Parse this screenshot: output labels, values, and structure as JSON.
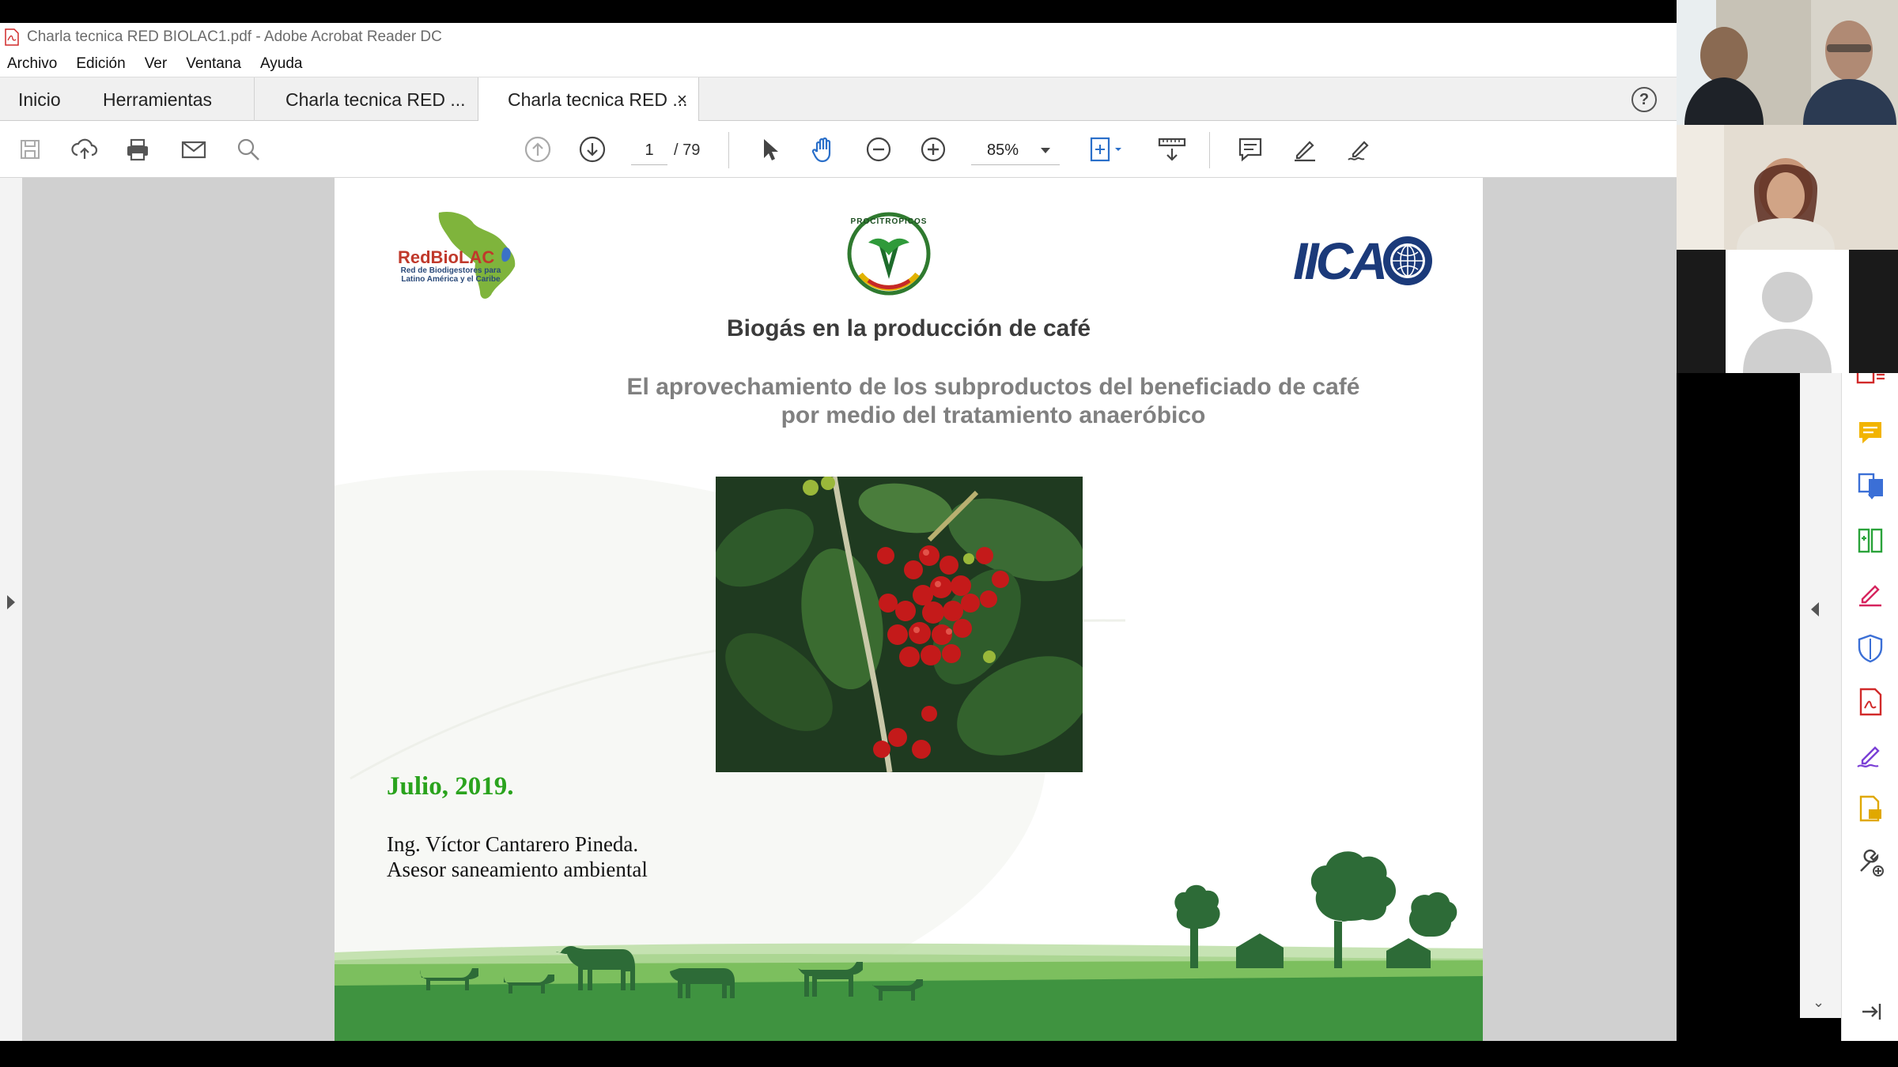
{
  "window": {
    "title": "Charla tecnica RED BIOLAC1.pdf - Adobe Acrobat Reader DC"
  },
  "menu": [
    "Archivo",
    "Edición",
    "Ver",
    "Ventana",
    "Ayuda"
  ],
  "tabs": {
    "home": "Inicio",
    "tools": "Herramientas",
    "doc1": "Charla tecnica RED ...",
    "doc2": "Charla tecnica RED ...",
    "close": "×",
    "help": "?"
  },
  "toolbar": {
    "page_current": "1",
    "page_total": "/ 79",
    "zoom": "85%"
  },
  "icons": {
    "toolbar": [
      "save-icon",
      "upload-icon",
      "print-icon",
      "email-icon",
      "find-icon",
      "page-up-icon",
      "page-down-icon",
      "select-arrow-icon",
      "hand-icon",
      "zoom-out-icon",
      "zoom-in-icon",
      "fit-page-icon",
      "scroll-mode-icon",
      "comment-icon",
      "highlight-pen-icon",
      "sign-icon"
    ],
    "right_tools": [
      "export-pdf-icon",
      "comment-icon",
      "export-convert-icon",
      "organize-pages-icon",
      "fill-sign-icon",
      "protect-icon",
      "create-pdf-icon",
      "edit-sign-icon",
      "send-review-icon",
      "more-tools-icon",
      "expand-pane-icon"
    ]
  },
  "colors": {
    "green_date": "#2aa31d",
    "title_text": "#3b3b3b",
    "subtitle_text": "#808080",
    "pasture_green": "#3f9340",
    "iica_blue": "#1b3a7a",
    "acrobat_red": "#d12a2a"
  },
  "slide": {
    "logo_left": {
      "name": "RedBioLAC",
      "sub": "Red de Biodigestores para Latino América y el Caribe"
    },
    "logo_center": "PROCITROPICOS",
    "logo_right": "IICA",
    "title": "Biogás en la producción de café",
    "subtitle_line1": "El aprovechamiento de los subproductos del beneficiado de café",
    "subtitle_line2": "por medio del tratamiento anaeróbico",
    "date": "Julio, 2019.",
    "author": "Ing. Víctor Cantarero Pineda.",
    "role": "Asesor saneamiento ambiental"
  }
}
